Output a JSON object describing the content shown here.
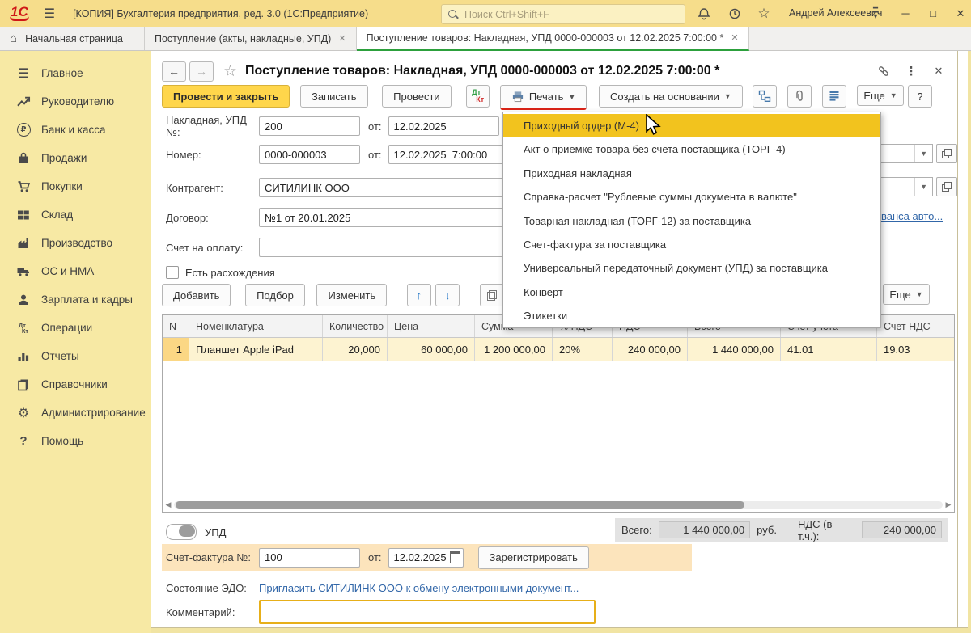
{
  "colors": {
    "accent_yellow": "#ffd64b",
    "menu_highlight": "#f2c31e",
    "tab_active_green": "#2ca03c",
    "link_blue": "#3166a8",
    "print_underline_red": "#da2317",
    "titlebar_yellow": "#f6dd8b",
    "sidebar_yellow": "#f7e9a4",
    "selected_row": "#fdf3d1"
  },
  "glyphs": {
    "dt": "Дт",
    "kt": "Кт"
  },
  "titlebar": {
    "logo": "1С",
    "app_title": "[КОПИЯ] Бухгалтерия предприятия, ред. 3.0  (1С:Предприятие)",
    "search_placeholder": "Поиск Ctrl+Shift+F",
    "user_name": "Андрей Алексеевич"
  },
  "tabs": {
    "home_label": "Начальная страница",
    "tab1_label": "Поступление (акты, накладные, УПД)",
    "tab2_label": "Поступление товаров: Накладная, УПД 0000-000003 от 12.02.2025 7:00:00 *"
  },
  "sidebar": {
    "items": [
      {
        "icon": "menu-icon",
        "label": "Главное"
      },
      {
        "icon": "trend-icon",
        "label": "Руководителю"
      },
      {
        "icon": "ruble-icon",
        "label": "Банк и касса"
      },
      {
        "icon": "bag-icon",
        "label": "Продажи"
      },
      {
        "icon": "cart-icon",
        "label": "Покупки"
      },
      {
        "icon": "warehouse-icon",
        "label": "Склад"
      },
      {
        "icon": "factory-icon",
        "label": "Производство"
      },
      {
        "icon": "truck-icon",
        "label": "ОС и НМА"
      },
      {
        "icon": "person-icon",
        "label": "Зарплата и кадры"
      },
      {
        "icon": "dtkt-icon",
        "label": "Операции"
      },
      {
        "icon": "barchart-icon",
        "label": "Отчеты"
      },
      {
        "icon": "books-icon",
        "label": "Справочники"
      },
      {
        "icon": "gear-icon",
        "label": "Администрирование"
      },
      {
        "icon": "question-icon",
        "label": "Помощь"
      }
    ]
  },
  "doc": {
    "title": "Поступление товаров: Накладная, УПД 0000-000003 от 12.02.2025 7:00:00 *",
    "toolbar": {
      "post_and_close": "Провести и закрыть",
      "write": "Записать",
      "post": "Провести",
      "print": "Печать",
      "create_based_on": "Создать на основании",
      "more": "Еще",
      "help": "?"
    },
    "fields": {
      "invoice_no": {
        "label": "Накладная, УПД №:",
        "value": "200",
        "from_label": "от:",
        "date": "12.02.2025"
      },
      "number": {
        "label": "Номер:",
        "value": "0000-000003",
        "from_label": "от:",
        "date": "12.02.2025  7:00:00"
      },
      "counterparty": {
        "label": "Контрагент:",
        "value": "СИТИЛИНК ООО"
      },
      "contract": {
        "label": "Договор:",
        "value": "№1 от 20.01.2025"
      },
      "payment_invoice": {
        "label": "Счет на оплату:",
        "value": ""
      },
      "discrepancy_checkbox_label": "Есть расхождения",
      "right_link_fragment": "ванса авто..."
    },
    "print_menu": {
      "items": [
        "Приходный ордер (М-4)",
        "Акт о приемке товара без счета поставщика (ТОРГ-4)",
        "Приходная накладная",
        "Справка-расчет \"Рублевые суммы документа в валюте\"",
        "Товарная накладная (ТОРГ-12) за поставщика",
        "Счет-фактура за поставщика",
        "Универсальный передаточный документ (УПД) за поставщика",
        "Конверт",
        "Этикетки"
      ]
    },
    "items_toolbar": {
      "add": "Добавить",
      "pick": "Подбор",
      "edit": "Изменить",
      "more": "Еще"
    },
    "table": {
      "headers": [
        "N",
        "Номенклатура",
        "Количество",
        "Цена",
        "Сумма",
        "% НДС",
        "НДС",
        "Всего",
        "Счет учета",
        "Счет НДС"
      ],
      "rows": [
        [
          "1",
          "Планшет Apple iPad",
          "20,000",
          "60 000,00",
          "1 200 000,00",
          "20%",
          "240 000,00",
          "1 440 000,00",
          "41.01",
          "19.03"
        ]
      ]
    },
    "footer": {
      "upd_toggle_label": "УПД",
      "total_label": "Всего:",
      "total_value": "1 440 000,00",
      "currency": "руб.",
      "vat_label": "НДС (в т.ч.):",
      "vat_value": "240 000,00",
      "invoice_label": "Счет-фактура №:",
      "invoice_number": "100",
      "invoice_from_label": "от:",
      "invoice_date": "12.02.2025",
      "register_button": "Зарегистрировать",
      "edo_label": "Состояние ЭДО:",
      "edo_link": "Пригласить СИТИЛИНК ООО к обмену электронными документ...",
      "comment_label": "Комментарий:"
    }
  }
}
